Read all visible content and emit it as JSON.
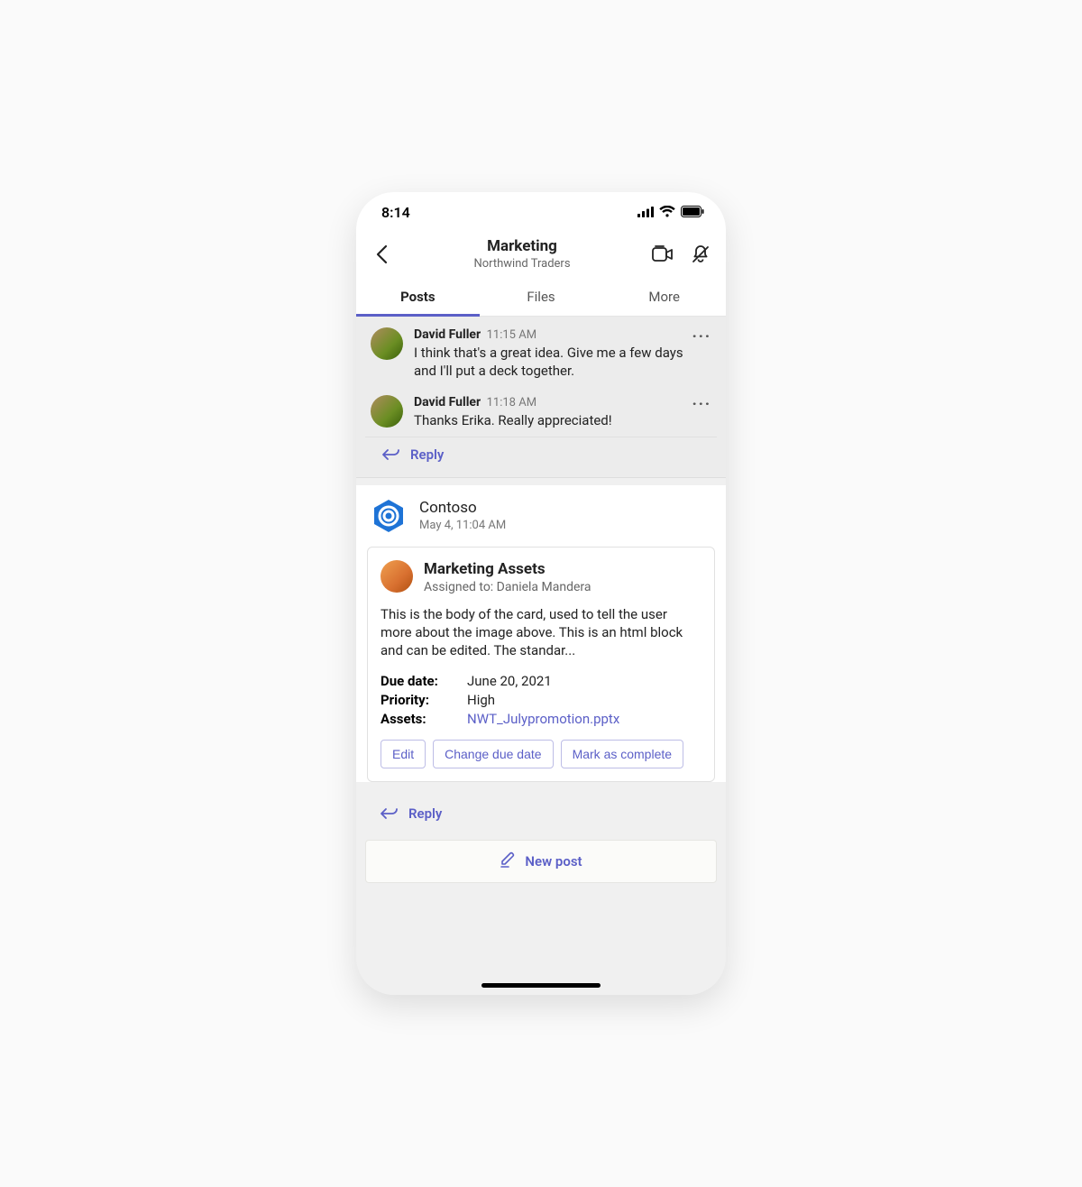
{
  "status": {
    "time": "8:14"
  },
  "header": {
    "title": "Marketing",
    "subtitle": "Northwind Traders"
  },
  "tabs": {
    "items": [
      "Posts",
      "Files",
      "More"
    ],
    "active": 0
  },
  "thread": {
    "messages": [
      {
        "name": "David Fuller",
        "time": "11:15 AM",
        "text": "I think that's a great idea. Give me a few days and I'll put a deck together."
      },
      {
        "name": "David Fuller",
        "time": "11:18 AM",
        "text": "Thanks Erika. Really appreciated!"
      }
    ],
    "reply_label": "Reply"
  },
  "bot": {
    "name": "Contoso",
    "time": "May 4, 11:04 AM"
  },
  "card": {
    "title": "Marketing Assets",
    "subtitle": "Assigned to: Daniela Mandera",
    "body": "This is the body of the card, used to tell the user more about the image above. This is an html block and can be edited. The standar...",
    "facts": [
      {
        "k": "Due date:",
        "v": "June 20, 2021",
        "link": false
      },
      {
        "k": "Priority:",
        "v": "High",
        "link": false
      },
      {
        "k": "Assets:",
        "v": "NWT_Julypromotion.pptx",
        "link": true
      }
    ],
    "actions": [
      "Edit",
      "Change due date",
      "Mark as complete"
    ]
  },
  "reply2_label": "Reply",
  "new_post_label": "New post"
}
